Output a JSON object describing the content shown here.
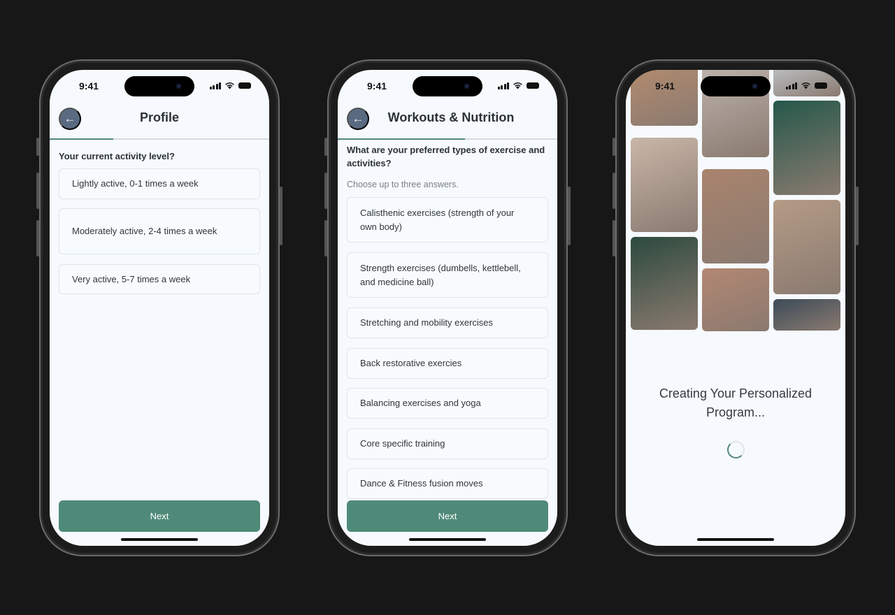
{
  "status_time": "9:41",
  "screens": [
    {
      "title": "Profile",
      "progress_percent": 29,
      "question": "Your current activity level?",
      "subtitle": "",
      "options": [
        "Lightly active, 0-1 times a week",
        "Moderately active, 2-4 times a week",
        "Very active, 5-7 times a week"
      ],
      "next_label": "Next"
    },
    {
      "title": "Workouts & Nutrition",
      "progress_percent": 58,
      "question": "What are your preferred types of exercise and activities?",
      "subtitle": "Choose up to three answers.",
      "options": [
        "Calisthenic exercises (strength of your own body)",
        "Strength exercises (dumbells, kettlebell, and medicine ball)",
        "Stretching and mobility exercises",
        "Back restorative exercies",
        "Balancing exercises and yoga",
        "Core specific training",
        "Dance & Fitness fusion moves"
      ],
      "next_label": "Next"
    },
    {
      "loading_text": "Creating Your Personalized Program..."
    }
  ],
  "colors": {
    "accent": "#4f8a78",
    "back_button": "#5a6a80",
    "background": "#f6f9fd"
  },
  "icons": {
    "back": "arrow-left-icon",
    "signal": "signal-icon",
    "wifi": "wifi-icon",
    "battery": "battery-icon",
    "loading": "spinner-icon"
  }
}
